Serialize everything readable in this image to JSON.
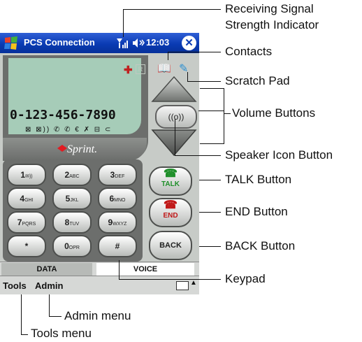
{
  "titlebar": {
    "app_title": "PCS Connection",
    "clock": "12:03"
  },
  "display": {
    "phone_number": "0-123-456-7890",
    "status_icons": "⊠ ⊠)) ✆ ✆ € ✗ ⊟ ⊂",
    "brand": "Sprint."
  },
  "keypad": {
    "keys": [
      {
        "digit": "1",
        "sub": "✉))"
      },
      {
        "digit": "2",
        "sub": "ABC"
      },
      {
        "digit": "3",
        "sub": "DEF"
      },
      {
        "digit": "4",
        "sub": "GHI"
      },
      {
        "digit": "5",
        "sub": "JKL"
      },
      {
        "digit": "6",
        "sub": "MNO"
      },
      {
        "digit": "7",
        "sub": "PQRS"
      },
      {
        "digit": "8",
        "sub": "TUV"
      },
      {
        "digit": "9",
        "sub": "WXYZ"
      },
      {
        "digit": "*",
        "sub": ""
      },
      {
        "digit": "0",
        "sub": "OPR"
      },
      {
        "digit": "#",
        "sub": ""
      }
    ]
  },
  "buttons": {
    "talk": "TALK",
    "end": "END",
    "back": "BACK"
  },
  "tabs": {
    "data": "DATA",
    "voice": "VOICE"
  },
  "menubar": {
    "tools": "Tools",
    "admin": "Admin"
  },
  "callouts": {
    "signal_line1": "Receiving Signal",
    "signal_line2": "Strength Indicator",
    "contacts": "Contacts",
    "scratch_pad": "Scratch Pad",
    "volume_buttons": "Volume Buttons",
    "speaker_icon_button": "Speaker Icon Button",
    "talk_button": "TALK Button",
    "end_button": "END Button",
    "back_button": "BACK Button",
    "keypad": "Keypad",
    "admin_menu": "Admin menu",
    "tools_menu": "Tools menu"
  },
  "colors": {
    "titlebar": "#0a3bb3",
    "lcd": "#a6ccb8",
    "talk_green": "#1f8f2a",
    "end_red": "#c01818"
  }
}
